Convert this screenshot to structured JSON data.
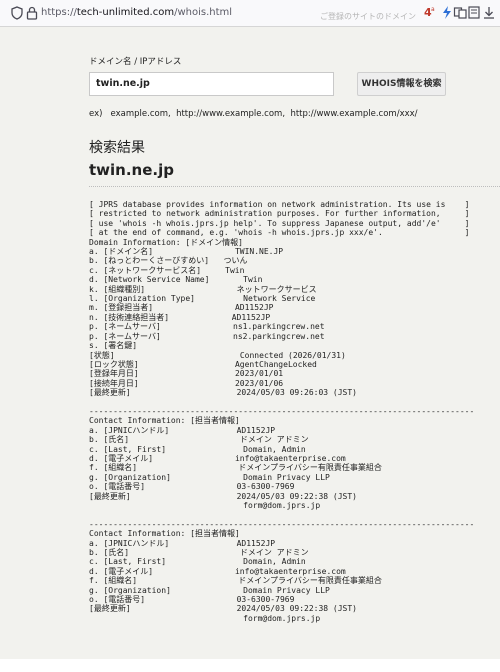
{
  "browser": {
    "url_prefix": "https://",
    "url_host": "tech-unlimited.com",
    "url_path": "/whois.html",
    "cutoff_text": "ご登録のサイトのドメイン",
    "icons": [
      "shield-icon",
      "lock-icon",
      "translate-icon",
      "lightning-icon",
      "extensions-icon",
      "reader-icon",
      "download-icon"
    ]
  },
  "form": {
    "label": "ドメイン名 / IPアドレス",
    "input_value": "twin.ne.jp",
    "button_label": "WHOIS情報を検索",
    "example": "ex)   example.com,  http://www.example.com,  http://www.example.com/xxx/"
  },
  "results": {
    "heading": "検索結果",
    "domain": "twin.ne.jp",
    "whois_lines": [
      "[ JPRS database provides information on network administration. Its use is    ]",
      "[ restricted to network administration purposes. For further information,     ]",
      "[ use 'whois -h whois.jprs.jp help'. To suppress Japanese output, add'/e'     ]",
      "[ at the end of command, e.g. 'whois -h whois.jprs.jp xxx/e'.                 ]",
      "Domain Information: [ドメイン情報]",
      "a. [ドメイン名]                 TWIN.NE.JP",
      "b. [ねっとわーくさーびすめい]   ついん",
      "c. [ネットワークサービス名]     Twin",
      "d. [Network Service Name]       Twin",
      "k. [組織種別]                   ネットワークサービス",
      "l. [Organization Type]          Network Service",
      "m. [登録担当者]                 AD1152JP",
      "n. [技術連絡担当者]             AD1152JP",
      "p. [ネームサーバ]               ns1.parkingcrew.net",
      "p. [ネームサーバ]               ns2.parkingcrew.net",
      "s. [署名鍵]",
      "[状態]                          Connected (2026/01/31)",
      "[ロック状態]                    AgentChangeLocked",
      "[登録年月日]                    2023/01/01",
      "[接続年月日]                    2023/01/06",
      "[最終更新]                      2024/05/03 09:26:03 (JST)",
      "",
      "--------------------------------------------------------------------------------",
      "Contact Information: [担当者情報]",
      "a. [JPNICハンドル]              AD1152JP",
      "b. [氏名]                       ドメイン アドミン",
      "c. [Last, First]                Domain, Admin",
      "d. [電子メイル]                 info@takaenterprise.com",
      "f. [組織名]                     ドメインプライバシー有限責任事業組合",
      "g. [Organization]               Domain Privacy LLP",
      "o. [電話番号]                   03-6300-7969",
      "[最終更新]                      2024/05/03 09:22:38 (JST)",
      "                                form@dom.jprs.jp",
      "",
      "--------------------------------------------------------------------------------",
      "Contact Information: [担当者情報]",
      "a. [JPNICハンドル]              AD1152JP",
      "b. [氏名]                       ドメイン アドミン",
      "c. [Last, First]                Domain, Admin",
      "d. [電子メイル]                 info@takaenterprise.com",
      "f. [組織名]                     ドメインプライバシー有限責任事業組合",
      "g. [Organization]               Domain Privacy LLP",
      "o. [電話番号]                   03-6300-7969",
      "[最終更新]                      2024/05/03 09:22:38 (JST)",
      "                                form@dom.jprs.jp"
    ]
  }
}
